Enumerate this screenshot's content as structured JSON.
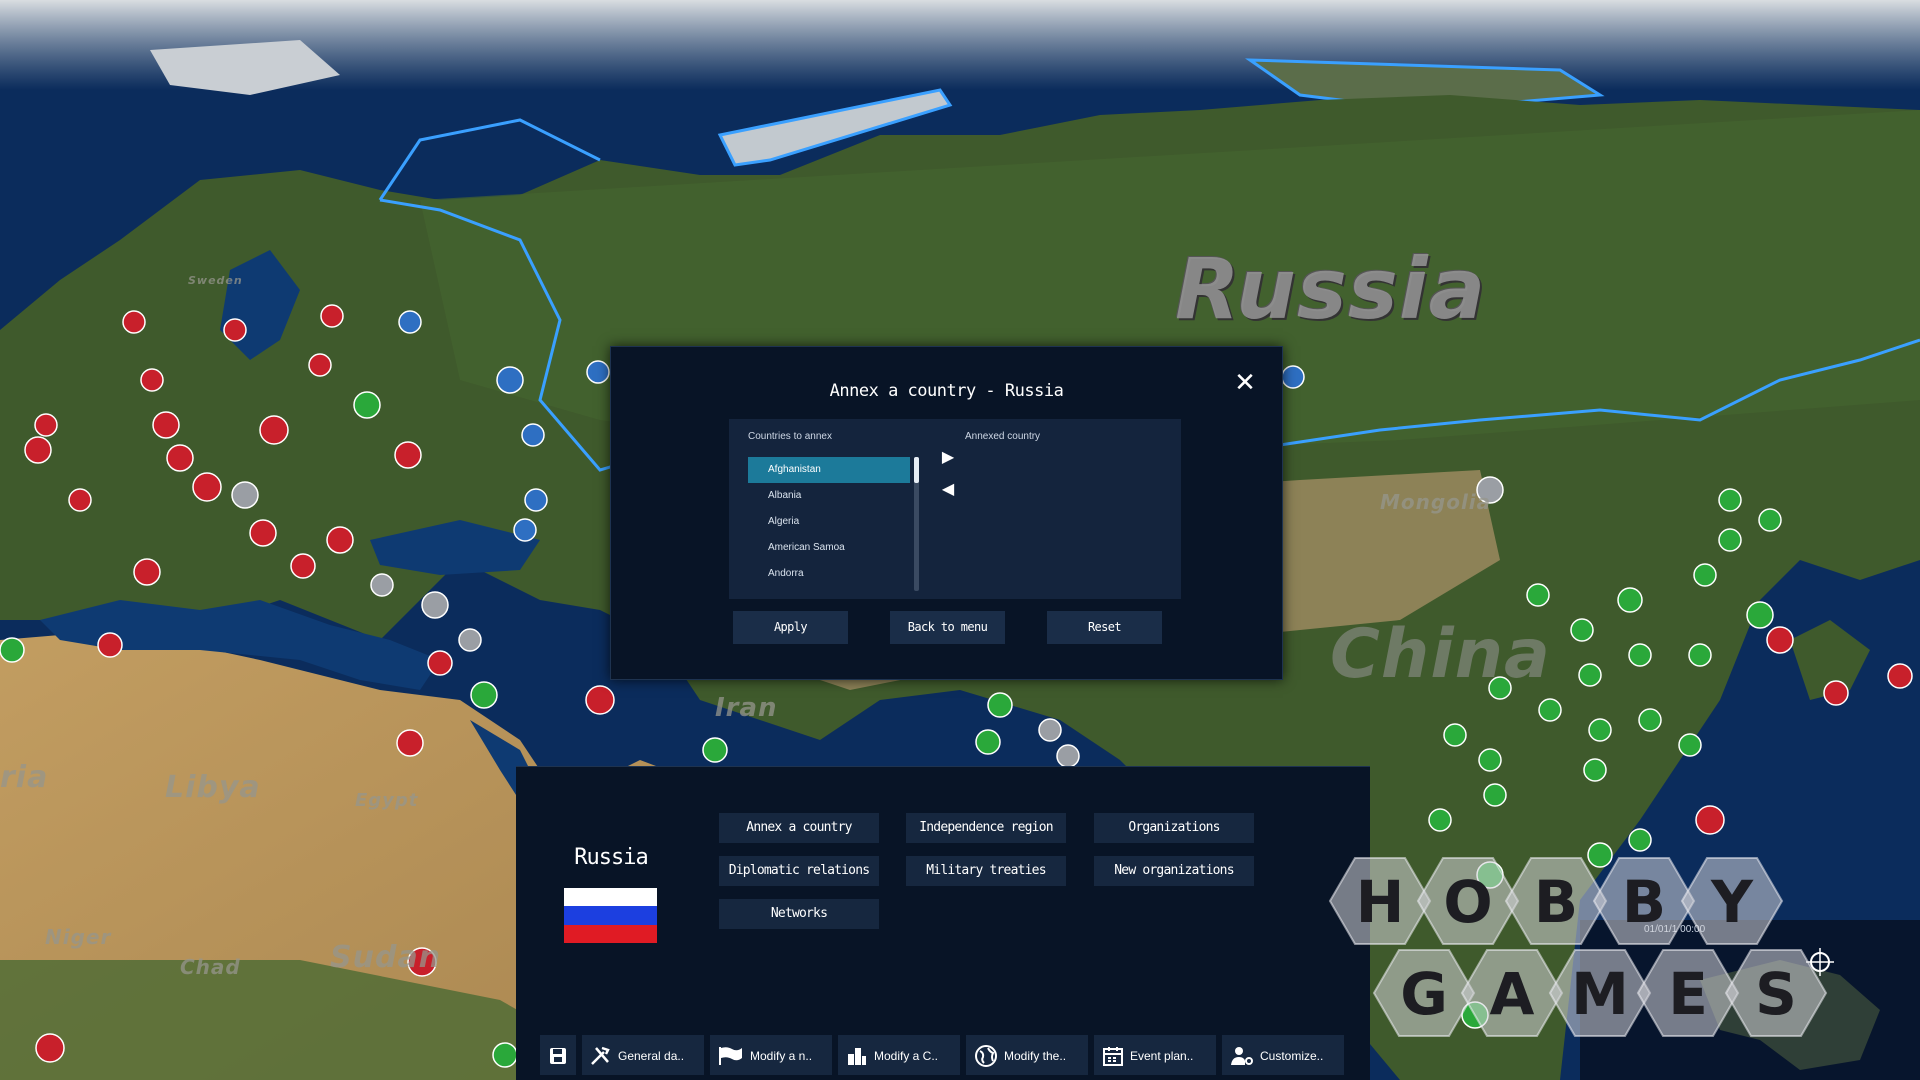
{
  "map": {
    "labels": {
      "russia": "Russia",
      "china": "China",
      "libya": "Libya",
      "egypt": "Egypt",
      "iran": "Iran",
      "sudan": "Sudan",
      "chad": "Chad",
      "niger": "Niger",
      "ria": "ria",
      "mongolia": "Mongolia",
      "sweden": "Sweden"
    },
    "colors": {
      "ocean": "#0b2c5c",
      "land_green": "#3d5a2a",
      "desert": "#b9975f",
      "ice": "#d8dde2",
      "border": "#3aa0ff",
      "marker_red": "#c8202b",
      "marker_green": "#2aa83a",
      "marker_blue": "#2e6fc2",
      "marker_gray": "#9a9ea4"
    }
  },
  "annex_dialog": {
    "title": "Annex a country - Russia",
    "close_icon": "close-icon",
    "countries_heading": "Countries to annex",
    "annexed_heading": "Annexed country",
    "countries": [
      "Afghanistan",
      "Albania",
      "Algeria",
      "American Samoa",
      "Andorra"
    ],
    "selected_country": "Afghanistan",
    "annexed": [],
    "buttons": {
      "apply": "Apply",
      "back": "Back to menu",
      "reset": "Reset"
    }
  },
  "bottom_panel": {
    "country_name": "Russia",
    "flag_colors": [
      "#ffffff",
      "#1c3fe0",
      "#e01b24"
    ],
    "actions": {
      "annex": "Annex a country",
      "independence": "Independence region",
      "organizations": "Organizations",
      "diplomatic": "Diplomatic relations",
      "military": "Military treaties",
      "new_orgs": "New organizations",
      "networks": "Networks"
    },
    "toolbar": {
      "save_icon": "save-icon",
      "general": "General da..",
      "modify_nation": "Modify a n..",
      "modify_city": "Modify a C..",
      "modify_world": "Modify the..",
      "event_plan": "Event plan..",
      "customize": "Customize.."
    }
  },
  "watermark": {
    "row1": [
      "H",
      "O",
      "B",
      "B",
      "Y"
    ],
    "row2": [
      "G",
      "A",
      "M",
      "E",
      "S"
    ]
  },
  "minimap": {
    "date": "01/01/1 00:00"
  }
}
